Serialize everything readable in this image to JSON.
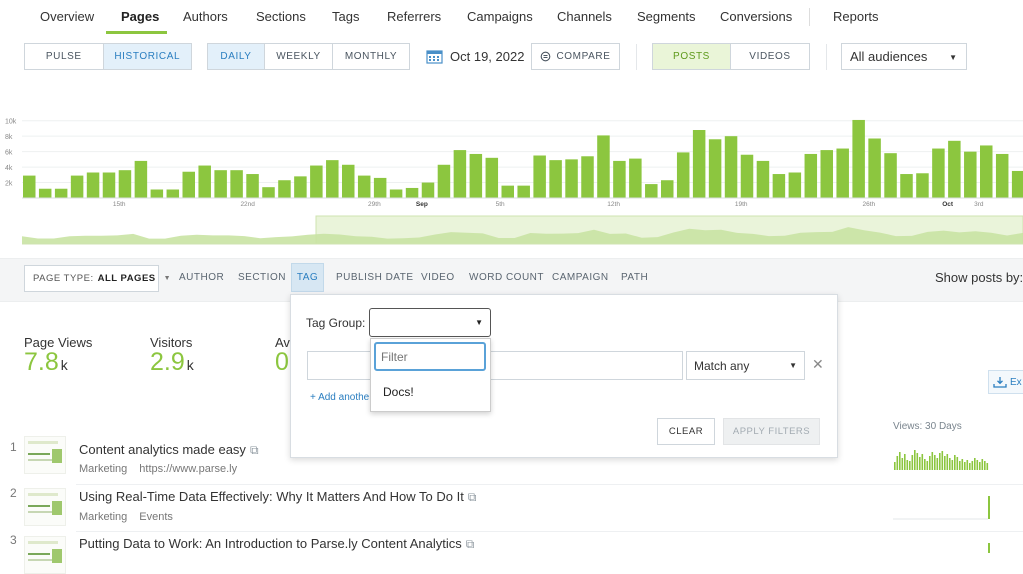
{
  "nav": {
    "items": [
      "Overview",
      "Pages",
      "Authors",
      "Sections",
      "Tags",
      "Referrers",
      "Campaigns",
      "Channels",
      "Segments",
      "Conversions",
      "Reports"
    ],
    "active": "Pages"
  },
  "controls": {
    "mode": [
      "PULSE",
      "HISTORICAL"
    ],
    "period": [
      "DAILY",
      "WEEKLY",
      "MONTHLY"
    ],
    "date": "Oct 19, 2022",
    "compare": "COMPARE",
    "content": [
      "POSTS",
      "VIDEOS"
    ],
    "audience": "All audiences"
  },
  "chart_data": {
    "type": "bar",
    "ytick_labels": [
      "10k",
      "8k",
      "6k",
      "4k",
      "2k"
    ],
    "xtick_labels": [
      "15th",
      "22nd",
      "29th",
      "Sep",
      "5th",
      "12th",
      "19th",
      "26th",
      "Oct",
      "3rd"
    ],
    "values": [
      2.9,
      1.2,
      1.2,
      2.9,
      3.3,
      3.3,
      3.6,
      4.8,
      1.1,
      1.1,
      3.4,
      4.2,
      3.6,
      3.6,
      3.1,
      1.4,
      2.3,
      2.8,
      4.2,
      4.9,
      4.3,
      2.9,
      2.6,
      1.1,
      1.3,
      2.0,
      4.3,
      6.2,
      5.7,
      5.2,
      1.6,
      1.6,
      5.5,
      4.9,
      5.0,
      5.4,
      8.1,
      4.8,
      5.1,
      1.8,
      2.3,
      5.9,
      8.8,
      7.6,
      8.0,
      5.6,
      4.8,
      3.1,
      3.3,
      5.7,
      6.2,
      6.4,
      10.1,
      7.7,
      5.8,
      3.1,
      3.2,
      6.4,
      7.4,
      6.0,
      6.8,
      5.7,
      3.5,
      5.6
    ],
    "ylim": [
      0,
      11
    ]
  },
  "filterbar": {
    "pagetype_label": "PAGE TYPE:",
    "pagetype_value": "ALL PAGES",
    "tabs": [
      "AUTHOR",
      "SECTION",
      "TAG",
      "PUBLISH DATE",
      "VIDEO",
      "WORD COUNT",
      "CAMPAIGN",
      "PATH"
    ],
    "active_tab": "TAG",
    "show_by": "Show posts by:"
  },
  "metrics": [
    {
      "label": "Page Views",
      "value": "7.8",
      "unit": "k"
    },
    {
      "label": "Visitors",
      "value": "2.9",
      "unit": "k"
    },
    {
      "label": "Av",
      "value": "0",
      "unit": ""
    }
  ],
  "popup": {
    "tag_group_label": "Tag Group:",
    "tag_group_value": "",
    "match": "Match any",
    "add_another": "+ Add anothe",
    "clear": "CLEAR",
    "apply": "APPLY FILTERS",
    "dropdown_placeholder": "Filter",
    "dropdown_option": "Docs!"
  },
  "list": {
    "views_header": "Views: 30 Days",
    "export": "Ex",
    "rows": [
      {
        "num": "1",
        "title": "Content analytics made easy",
        "section": "Marketing",
        "url": "https://www.parse.ly"
      },
      {
        "num": "2",
        "title": "Using Real-Time Data Effectively: Why It Matters And How To Do It",
        "section": "Marketing",
        "url": "Events"
      },
      {
        "num": "3",
        "title": "Putting Data to Work: An Introduction to Parse.ly Content Analytics",
        "section": "",
        "url": ""
      }
    ]
  }
}
